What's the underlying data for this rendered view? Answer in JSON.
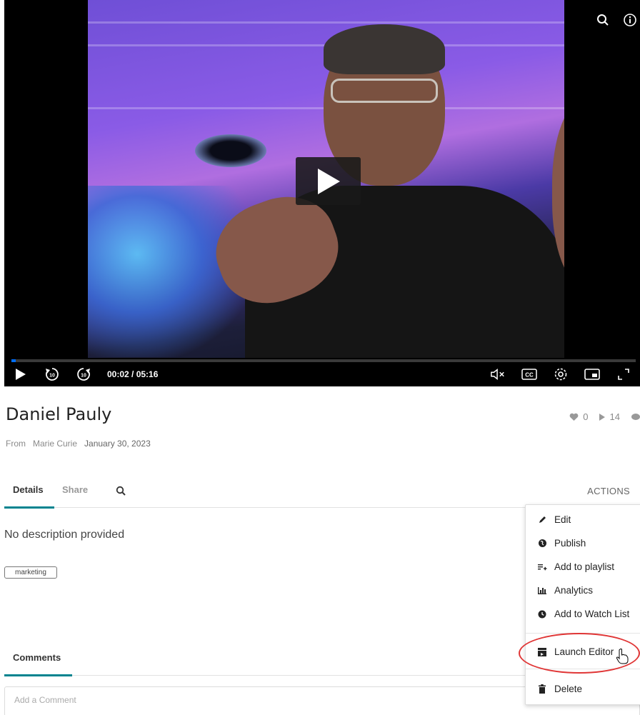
{
  "player": {
    "time_display": "00:02 / 05:16",
    "progress": 0.007,
    "accent_color": "#006efa",
    "rewind_label": "10",
    "forward_label": "10",
    "captions_label": "CC",
    "top_icons": [
      "search-icon",
      "info-icon"
    ],
    "control_icons": [
      "play-icon",
      "rewind-10-icon",
      "forward-10-icon",
      "mute-icon",
      "captions-icon",
      "settings-icon",
      "pip-icon",
      "fullscreen-icon"
    ]
  },
  "entry": {
    "title": "Daniel Pauly",
    "likes": "0",
    "plays": "14",
    "from_label": "From",
    "owner": "Marie Curie",
    "date": "January 30, 2023"
  },
  "tabs": {
    "details": "Details",
    "share": "Share",
    "actions": "ACTIONS"
  },
  "details": {
    "description": "No description provided",
    "tag": "marketing"
  },
  "comments": {
    "tab": "Comments",
    "placeholder": "Add a Comment"
  },
  "actions_menu": {
    "items": [
      {
        "label": "Edit",
        "icon": "pencil-icon"
      },
      {
        "label": "Publish",
        "icon": "globe-icon"
      },
      {
        "label": "Add to playlist",
        "icon": "playlist-add-icon"
      },
      {
        "label": "Analytics",
        "icon": "analytics-icon"
      },
      {
        "label": "Add to Watch List",
        "icon": "clock-icon"
      },
      {
        "label": "Launch Editor",
        "icon": "clapperboard-icon"
      },
      {
        "label": "Delete",
        "icon": "trash-icon"
      }
    ],
    "highlight_color": "#e03636"
  }
}
